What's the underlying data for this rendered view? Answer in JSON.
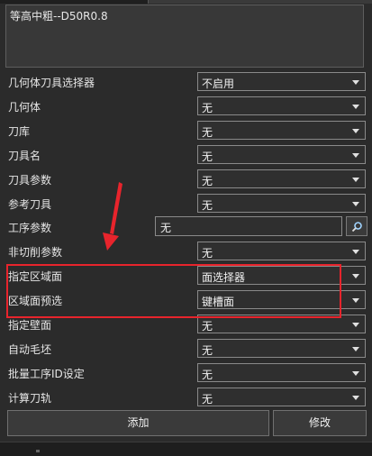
{
  "description": {
    "text": "等高中粗--D50R0.8"
  },
  "rows": [
    {
      "label": "几何体刀具选择器",
      "type": "select",
      "value": "不启用"
    },
    {
      "label": "几何体",
      "type": "select",
      "value": "无"
    },
    {
      "label": "刀库",
      "type": "select",
      "value": "无"
    },
    {
      "label": "刀具名",
      "type": "select",
      "value": "无"
    },
    {
      "label": "刀具参数",
      "type": "select",
      "value": "无"
    },
    {
      "label": "参考刀具",
      "type": "select",
      "value": "无"
    },
    {
      "label": "工序参数",
      "type": "text",
      "value": "无"
    },
    {
      "label": "非切削参数",
      "type": "select",
      "value": "无"
    },
    {
      "label": "指定区域面",
      "type": "select",
      "value": "面选择器"
    },
    {
      "label": "区域面预选",
      "type": "select",
      "value": "键槽面"
    },
    {
      "label": "指定壁面",
      "type": "select",
      "value": "无"
    },
    {
      "label": "自动毛坯",
      "type": "select",
      "value": "无"
    },
    {
      "label": "批量工序ID设定",
      "type": "select",
      "value": "无"
    },
    {
      "label": "计算刀轨",
      "type": "select",
      "value": "无"
    }
  ],
  "buttons": {
    "add": "添加",
    "modify": "修改"
  },
  "icons": {
    "search": "search-icon",
    "arrow": "annotation-arrow"
  },
  "colors": {
    "annotation": "#e8242c",
    "background": "#2b2b2b"
  }
}
